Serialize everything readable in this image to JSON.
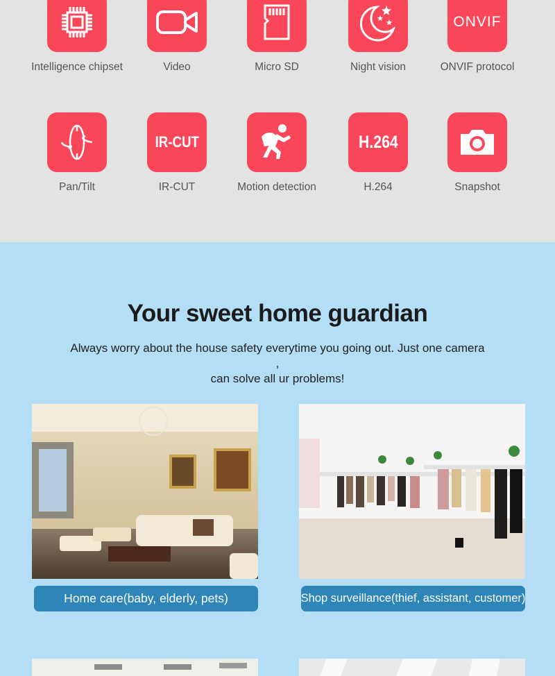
{
  "features": [
    {
      "label": "Intelligence  chipset",
      "icon": "chip-icon"
    },
    {
      "label": "Video",
      "icon": "video-camera-icon"
    },
    {
      "label": "Micro SD",
      "icon": "sd-card-icon"
    },
    {
      "label": "Night vision",
      "icon": "moon-stars-icon"
    },
    {
      "label": "ONVIF protocol",
      "icon": "onvif-logo-icon",
      "icon_text": "ONVIF"
    },
    {
      "label": "Pan/Tilt",
      "icon": "rotate-icon"
    },
    {
      "label": "IR-CUT",
      "icon": "ir-cut-icon",
      "icon_text": "IR-CUT"
    },
    {
      "label": "Motion detection",
      "icon": "thief-icon"
    },
    {
      "label": "H.264",
      "icon": "h264-icon",
      "icon_text": "H.264"
    },
    {
      "label": "Snapshot",
      "icon": "camera-icon"
    }
  ],
  "section": {
    "title": "Your sweet home guardian",
    "desc_line1": "Always worry about the house safety everytime you going out. Just one camera ,",
    "desc_line2": "can solve all ur problems!"
  },
  "scenes": [
    {
      "caption": "Home  care(baby, elderly, pets)"
    },
    {
      "caption": "Shop  surveillance(thief, assistant, customer)"
    }
  ],
  "colors": {
    "accent": "#fa4659",
    "caption_bg": "#2e86b8",
    "top_bg": "#e3e3e3",
    "bottom_bg": "#b3def6"
  }
}
